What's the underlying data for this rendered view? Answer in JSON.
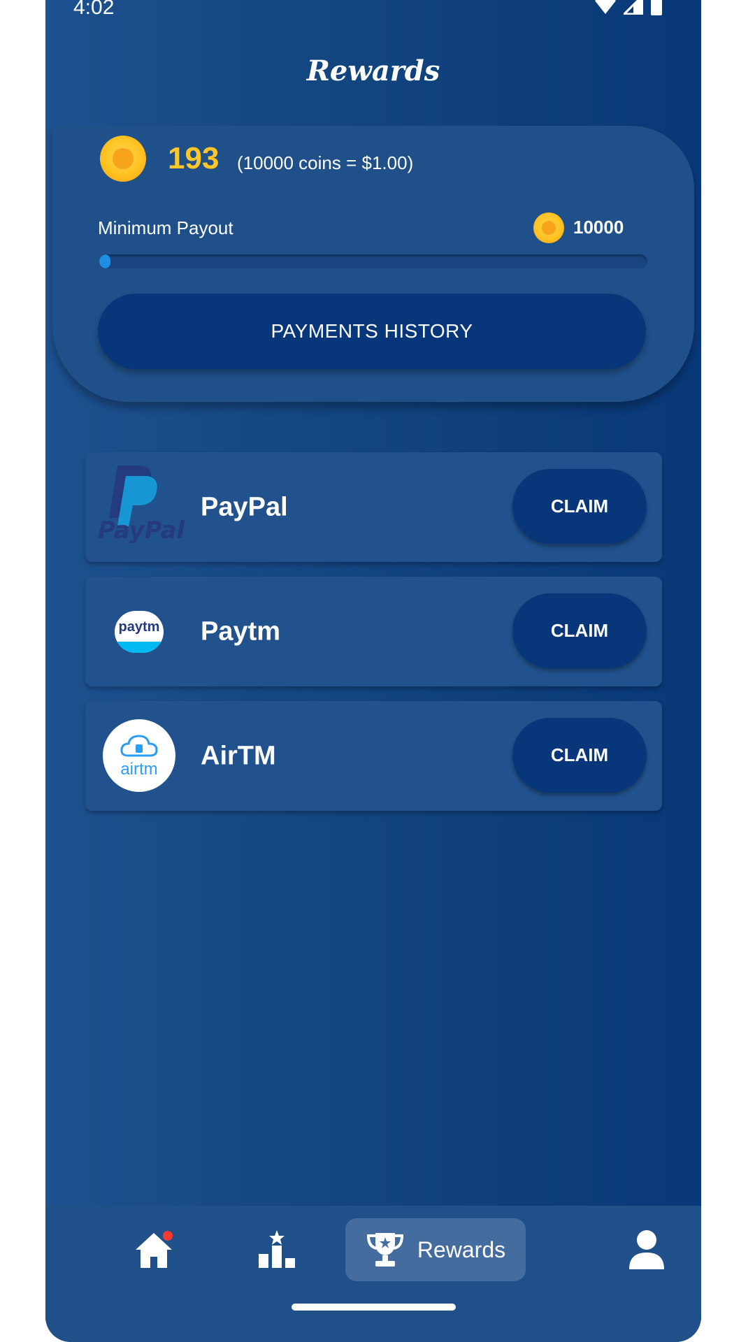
{
  "status_bar": {
    "time": "4:02",
    "icons": [
      "wifi-icon",
      "signal-icon",
      "battery-icon"
    ]
  },
  "header": {
    "title": "Rewards"
  },
  "balance": {
    "coins": "193",
    "rate": "(10000 coins = $1.00)",
    "minimum_label": "Minimum Payout",
    "minimum_value": "10000",
    "progress_fraction": 0.0193,
    "history_button": "PAYMENTS HISTORY"
  },
  "methods": [
    {
      "name": "PayPal",
      "claim": "CLAIM",
      "logo_text": "PayPal"
    },
    {
      "name": "Paytm",
      "claim": "CLAIM",
      "logo_text": "paytm"
    },
    {
      "name": "AirTM",
      "claim": "CLAIM",
      "logo_text": "airtm"
    }
  ],
  "nav": {
    "items": [
      {
        "icon": "home-icon",
        "label": ""
      },
      {
        "icon": "leaderboard-icon",
        "label": ""
      },
      {
        "icon": "trophy-icon",
        "label": "Rewards"
      },
      {
        "icon": "profile-icon",
        "label": ""
      }
    ]
  },
  "colors": {
    "background": "#13457f",
    "card": "#1f5089",
    "button": "#07377a",
    "coin": "#ffc629",
    "progress": "#1e8ee3"
  }
}
